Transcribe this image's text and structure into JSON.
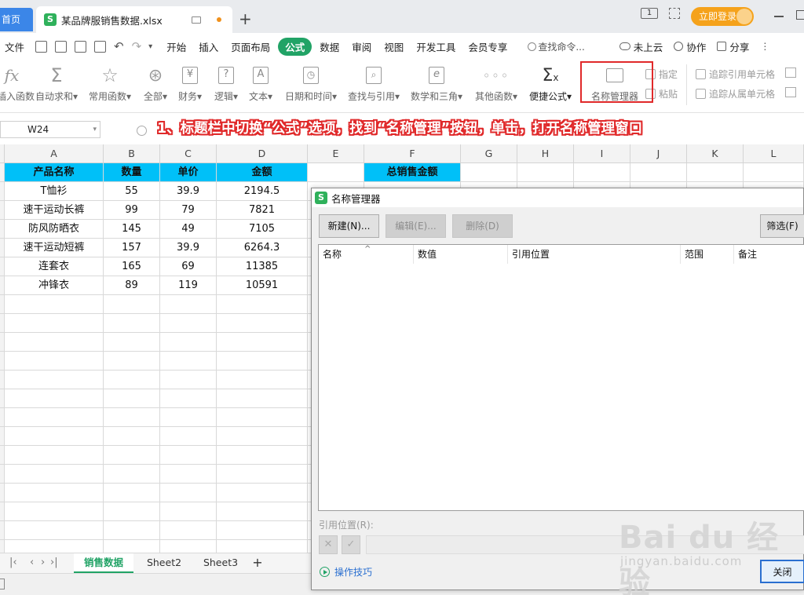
{
  "titlebar": {
    "home_tab": "首页",
    "file_name": "某品牌服销售数据.xlsx",
    "add_tab": "+",
    "page_indicator": "1",
    "login": "立即登录"
  },
  "menubar": {
    "file": "文件",
    "tabs": [
      "开始",
      "插入",
      "页面布局",
      "公式",
      "数据",
      "审阅",
      "视图",
      "开发工具",
      "会员专享"
    ],
    "active_tab": "公式",
    "search": "查找命令...",
    "cloud": "未上云",
    "collab": "协作",
    "share": "分享"
  },
  "ribbon": {
    "buttons": [
      "插入函数",
      "自动求和▾",
      "常用函数▾",
      "全部▾",
      "财务▾",
      "逻辑▾",
      "文本▾",
      "日期和时间▾",
      "查找与引用▾",
      "数学和三角▾",
      "其他函数▾",
      "便捷公式▾",
      "名称管理器"
    ],
    "small": [
      "指定",
      "粘贴",
      "追踪引用单元格",
      "追踪从属单元格"
    ]
  },
  "formula_bar": {
    "cell_ref": "W24"
  },
  "annotation": "1、标题栏中切换“公式”选项，找到“名称管理”按钮，单击，打开名称管理窗口",
  "grid": {
    "columns": [
      "A",
      "B",
      "C",
      "D",
      "E",
      "F",
      "G",
      "H",
      "I",
      "J",
      "K",
      "L"
    ],
    "header_row": [
      "产品名称",
      "数量",
      "单价",
      "金额",
      "",
      "总销售金额"
    ],
    "rows": [
      [
        "T恤衫",
        "55",
        "39.9",
        "2194.5"
      ],
      [
        "速干运动长裤",
        "99",
        "79",
        "7821"
      ],
      [
        "防风防晒衣",
        "145",
        "49",
        "7105"
      ],
      [
        "速干运动短裤",
        "157",
        "39.9",
        "6264.3"
      ],
      [
        "连套衣",
        "165",
        "69",
        "11385"
      ],
      [
        "冲锋衣",
        "89",
        "119",
        "10591"
      ]
    ]
  },
  "sheets": {
    "tabs": [
      "销售数据",
      "Sheet2",
      "Sheet3"
    ],
    "active": "销售数据",
    "add": "+"
  },
  "dialog": {
    "title": "名称管理器",
    "new_btn": "新建(N)...",
    "edit_btn": "编辑(E)...",
    "delete_btn": "删除(D)",
    "filter_btn": "筛选(F)",
    "columns": [
      "名称",
      "数值",
      "引用位置",
      "范围",
      "备注"
    ],
    "refer_label": "引用位置(R):",
    "cancel_ref": "✕",
    "confirm_ref": "✓",
    "tips": "操作技巧",
    "close_btn": "关闭"
  },
  "watermark": {
    "brand": "Bai du 经验",
    "url": "jingyan.baidu.com"
  }
}
